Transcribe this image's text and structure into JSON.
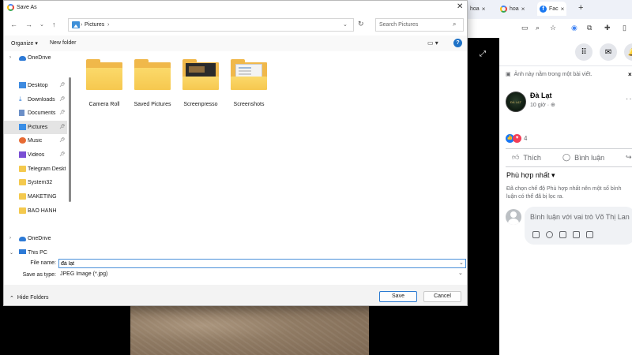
{
  "browser": {
    "tabs": [
      {
        "label": "hoa",
        "icon": "google-icon"
      },
      {
        "label": "hoa",
        "icon": "google-icon"
      },
      {
        "label": "Fac",
        "icon": "facebook-icon",
        "active": true
      }
    ],
    "new_tab": "+"
  },
  "facebook": {
    "note": "Ảnh này nằm trong một bài viết.",
    "post": {
      "author": "Đà Lạt",
      "time": "10 giờ ·"
    },
    "reactions_count": "4",
    "actions": {
      "like": "Thích",
      "comment": "Bình luận"
    },
    "sort": {
      "label": "Phù hợp nhất",
      "description": "Đã chọn chế độ Phù hợp nhất nên một số bình luận có thể đã bị lọc ra."
    },
    "comment_placeholder": "Bình luận với vai trò Võ Thị Lan"
  },
  "dialog": {
    "title": "Save As",
    "breadcrumb": [
      "Pictures"
    ],
    "search_placeholder": "Search Pictures",
    "organize": "Organize ▾",
    "new_folder": "New folder",
    "sidebar": [
      {
        "label": "OneDrive",
        "icon": "cloud-icon",
        "chevron": "›"
      },
      {
        "label": "Desktop",
        "icon": "desktop-icon",
        "pinned": true
      },
      {
        "label": "Downloads",
        "icon": "download-icon",
        "pinned": true
      },
      {
        "label": "Documents",
        "icon": "documents-icon",
        "pinned": true
      },
      {
        "label": "Pictures",
        "icon": "pictures-icon",
        "pinned": true,
        "selected": true
      },
      {
        "label": "Music",
        "icon": "music-icon",
        "pinned": true
      },
      {
        "label": "Videos",
        "icon": "videos-icon",
        "pinned": true
      },
      {
        "label": "Telegram Desktop",
        "icon": "folder-icon"
      },
      {
        "label": "System32",
        "icon": "folder-icon"
      },
      {
        "label": "MAKETING",
        "icon": "folder-icon"
      },
      {
        "label": "BẢO HÀNH",
        "icon": "folder-icon"
      },
      {
        "label": "OneDrive",
        "icon": "cloud-icon",
        "chevron": "›"
      },
      {
        "label": "This PC",
        "icon": "pc-icon",
        "chevron": "⌄"
      }
    ],
    "files": [
      {
        "name": "Camera Roll",
        "thumb": "plain"
      },
      {
        "name": "Saved Pictures",
        "thumb": "plain"
      },
      {
        "name": "Screenpresso",
        "thumb": "dark"
      },
      {
        "name": "Screenshots",
        "thumb": "shot"
      }
    ],
    "file_name_label": "File name:",
    "file_name_value": "đà lạt",
    "save_type_label": "Save as type:",
    "save_type_value": "JPEG Image (*.jpg)",
    "hide_folders": "Hide Folders",
    "save_button": "Save",
    "cancel_button": "Cancel"
  },
  "colors": {
    "accent": "#1e72c7",
    "facebook_blue": "#1877f2",
    "folder_yellow": "#f6c84f"
  }
}
